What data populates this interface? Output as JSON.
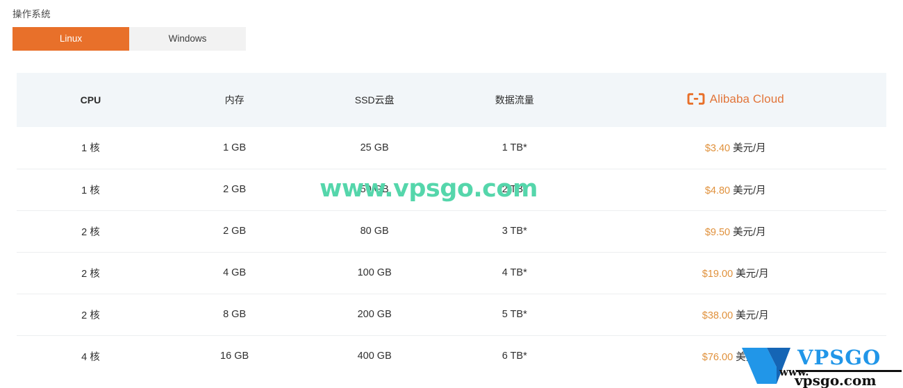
{
  "os_selector": {
    "label": "操作系统",
    "tabs": [
      {
        "label": "Linux",
        "active": true
      },
      {
        "label": "Windows",
        "active": false
      }
    ]
  },
  "table": {
    "headers": {
      "cpu": "CPU",
      "memory": "内存",
      "ssd": "SSD云盘",
      "traffic": "数据流量",
      "provider": "Alibaba Cloud"
    },
    "rows": [
      {
        "cpu": "1 核",
        "memory": "1 GB",
        "ssd": "25 GB",
        "traffic": "1 TB*",
        "price_amount": "$3.40",
        "price_unit": "美元/月"
      },
      {
        "cpu": "1 核",
        "memory": "2 GB",
        "ssd": "50 GB",
        "traffic": "2 TB*",
        "price_amount": "$4.80",
        "price_unit": "美元/月"
      },
      {
        "cpu": "2 核",
        "memory": "2 GB",
        "ssd": "80 GB",
        "traffic": "3 TB*",
        "price_amount": "$9.50",
        "price_unit": "美元/月"
      },
      {
        "cpu": "2 核",
        "memory": "4 GB",
        "ssd": "100 GB",
        "traffic": "4 TB*",
        "price_amount": "$19.00",
        "price_unit": "美元/月"
      },
      {
        "cpu": "2 核",
        "memory": "8 GB",
        "ssd": "200 GB",
        "traffic": "5 TB*",
        "price_amount": "$38.00",
        "price_unit": "美元/月"
      },
      {
        "cpu": "4 核",
        "memory": "16 GB",
        "ssd": "400 GB",
        "traffic": "6 TB*",
        "price_amount": "$76.00",
        "price_unit": "美元/月"
      }
    ]
  },
  "watermarks": {
    "center_text": "www.vpsgo.com",
    "logo_brand": "VPSGO",
    "logo_prefix": "www.",
    "logo_domain": "vpsgo.com"
  },
  "colors": {
    "accent_orange": "#e8702a",
    "price_orange": "#e0913c",
    "logo_orange": "#e2753a",
    "header_bg": "#f2f6f9",
    "row_border": "#eceef0",
    "watermark_green": "#55d6ab",
    "watermark_blue": "#1b8ad6"
  }
}
